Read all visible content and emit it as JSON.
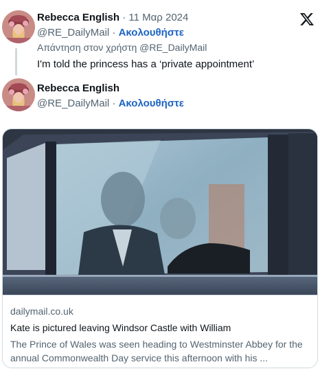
{
  "colors": {
    "text_primary": "#0f1419",
    "text_secondary": "#536471",
    "follow_link": "#1d64c2",
    "border": "#cfd9de"
  },
  "top_bar": {
    "logo_icon": "x-logo-icon"
  },
  "reply_tweet": {
    "author_name": "Rebecca English",
    "separator": " · ",
    "date": "11 Μαρ 2024",
    "handle": "@RE_DailyMail",
    "handle_separator": " · ",
    "follow_label": "Ακολουθήστε",
    "reply_to": "Απάντηση στον χρήστη @RE_DailyMail",
    "text": "I'm told the princess has a ‘private appointment’"
  },
  "quoted_author": {
    "author_name": "Rebecca English",
    "handle": "@RE_DailyMail",
    "handle_separator": " · ",
    "follow_label": "Ακολουθήστε"
  },
  "link_card": {
    "domain": "dailymail.co.uk",
    "title": "Kate is pictured leaving Windsor Castle with William",
    "description": "The Prince of Wales was seen heading to Westminster Abbey for the annual Commonwealth Day service this afternoon with his ..."
  }
}
